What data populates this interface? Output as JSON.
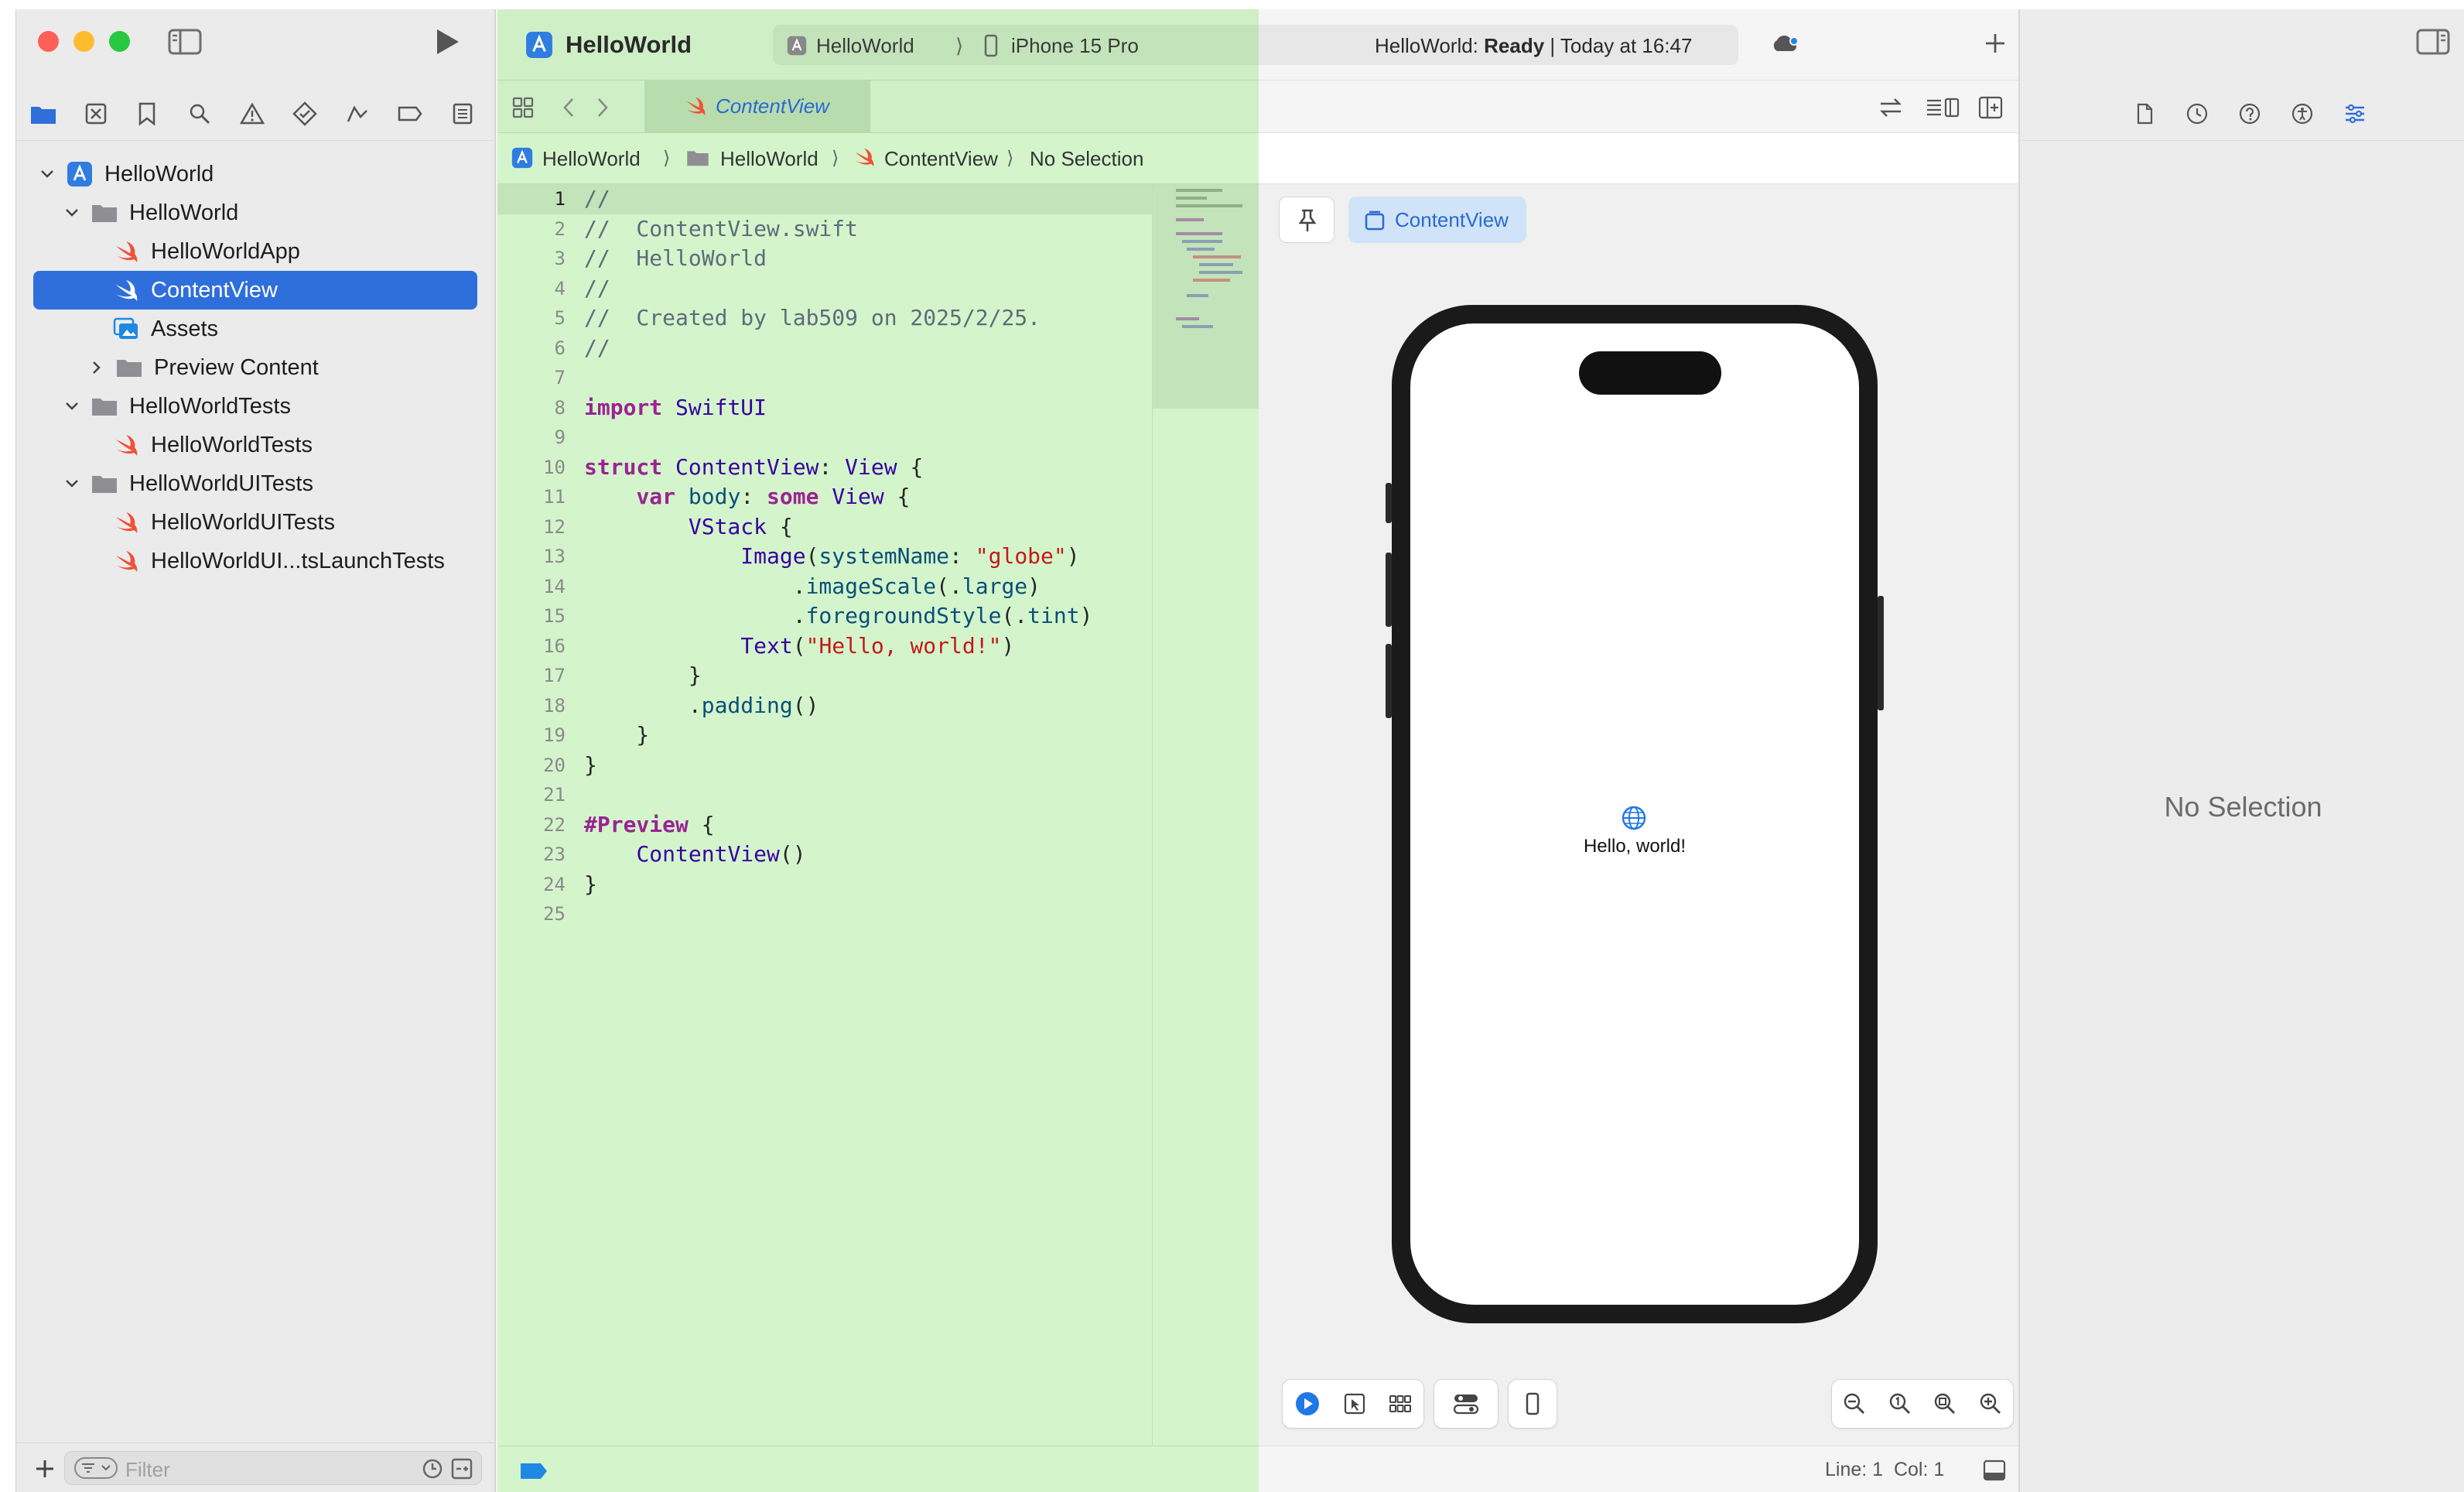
{
  "project": {
    "name": "HelloWorld"
  },
  "toolbar": {
    "scheme": "HelloWorld",
    "destination": "iPhone 15 Pro",
    "status_prefix": "HelloWorld: ",
    "status_state": "Ready",
    "status_suffix": " | Today at 16:47"
  },
  "tab": {
    "label": "ContentView"
  },
  "jumpbar": {
    "items": [
      "HelloWorld",
      "HelloWorld",
      "ContentView",
      "No Selection"
    ]
  },
  "navigator": {
    "items": [
      {
        "label": "HelloWorld"
      },
      {
        "label": "HelloWorld"
      },
      {
        "label": "HelloWorldApp"
      },
      {
        "label": "ContentView"
      },
      {
        "label": "Assets"
      },
      {
        "label": "Preview Content"
      },
      {
        "label": "HelloWorldTests"
      },
      {
        "label": "HelloWorldTests"
      },
      {
        "label": "HelloWorldUITests"
      },
      {
        "label": "HelloWorldUITests"
      },
      {
        "label": "HelloWorldUI...tsLaunchTests"
      }
    ],
    "filter_placeholder": "Filter"
  },
  "code": {
    "lines": [
      "//",
      "//  ContentView.swift",
      "//  HelloWorld",
      "//",
      "//  Created by lab509 on 2025/2/25.",
      "//",
      "",
      "import SwiftUI",
      "",
      "struct ContentView: View {",
      "    var body: some View {",
      "        VStack {",
      "            Image(systemName: \"globe\")",
      "                .imageScale(.large)",
      "                .foregroundStyle(.tint)",
      "            Text(\"Hello, world!\")",
      "        }",
      "        .padding()",
      "    }",
      "}",
      "",
      "#Preview {",
      "    ContentView()",
      "}",
      ""
    ]
  },
  "preview": {
    "tab_label": "ContentView",
    "hello_text": "Hello, world!"
  },
  "status": {
    "line_col": "Line: 1  Col: 1"
  },
  "inspector": {
    "empty_label": "No Selection"
  },
  "colors": {
    "accent": "#2f6fdc",
    "editor_highlight": "#d4f5cc",
    "swift_orange": "#f05138"
  }
}
